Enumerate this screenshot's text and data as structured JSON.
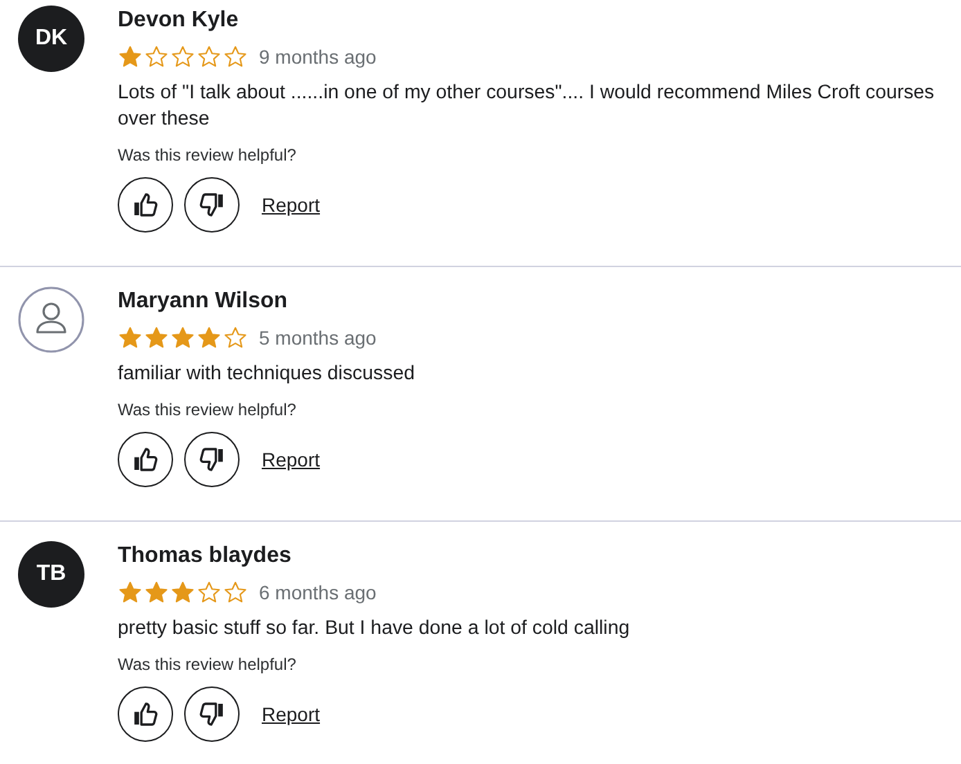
{
  "reviews": [
    {
      "avatar": {
        "kind": "initials",
        "initials": "DK"
      },
      "name": "Devon Kyle",
      "stars": 1,
      "time": "9 months ago",
      "text": "Lots of \"I talk about ......in one of my other courses\".... I would recommend Miles Croft courses over these",
      "helpful_prompt": "Was this review helpful?",
      "report": "Report"
    },
    {
      "avatar": {
        "kind": "placeholder"
      },
      "name": "Maryann Wilson",
      "stars": 4,
      "time": "5 months ago",
      "text": "familiar with techniques discussed",
      "helpful_prompt": "Was this review helpful?",
      "report": "Report"
    },
    {
      "avatar": {
        "kind": "initials",
        "initials": "TB"
      },
      "name": "Thomas blaydes",
      "stars": 3,
      "time": "6 months ago",
      "text": "pretty basic stuff so far. But I have done a lot of cold calling",
      "helpful_prompt": "Was this review helpful?",
      "report": "Report"
    }
  ]
}
